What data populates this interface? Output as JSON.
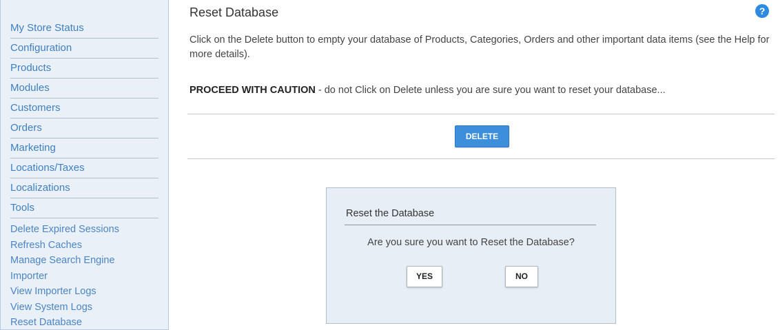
{
  "sidebar": {
    "menu": [
      {
        "label": "My Store Status"
      },
      {
        "label": "Configuration"
      },
      {
        "label": "Products"
      },
      {
        "label": "Modules"
      },
      {
        "label": "Customers"
      },
      {
        "label": "Orders"
      },
      {
        "label": "Marketing"
      },
      {
        "label": "Locations/Taxes"
      },
      {
        "label": "Localizations"
      },
      {
        "label": "Tools"
      }
    ],
    "tools_submenu": [
      {
        "label": "Delete Expired Sessions"
      },
      {
        "label": "Refresh Caches"
      },
      {
        "label": "Manage Search Engine"
      },
      {
        "label": "Importer"
      },
      {
        "label": "View Importer Logs"
      },
      {
        "label": "View System Logs"
      },
      {
        "label": "Reset Database"
      }
    ]
  },
  "main": {
    "title": "Reset Database",
    "help_icon": {
      "icon": "question-mark",
      "glyph": "?",
      "color": "#2e8ae0"
    },
    "intro": "Click on the Delete button to empty your database of Products, Categories, Orders and other important data items (see the Help for more details).",
    "caution_strong": "PROCEED WITH CAUTION",
    "caution_rest": " - do not Click on Delete unless you are sure you want to reset your database...",
    "delete_label": "DELETE"
  },
  "dialog": {
    "title": "Reset the Database",
    "question": "Are you sure you want to Reset the Database?",
    "yes_label": "YES",
    "no_label": "NO"
  },
  "colors": {
    "link": "#3e7fc1",
    "sidebar_bg": "#eaf0f8",
    "primary_button": "#3d8fdb",
    "dialog_bg": "#e8eef6"
  }
}
